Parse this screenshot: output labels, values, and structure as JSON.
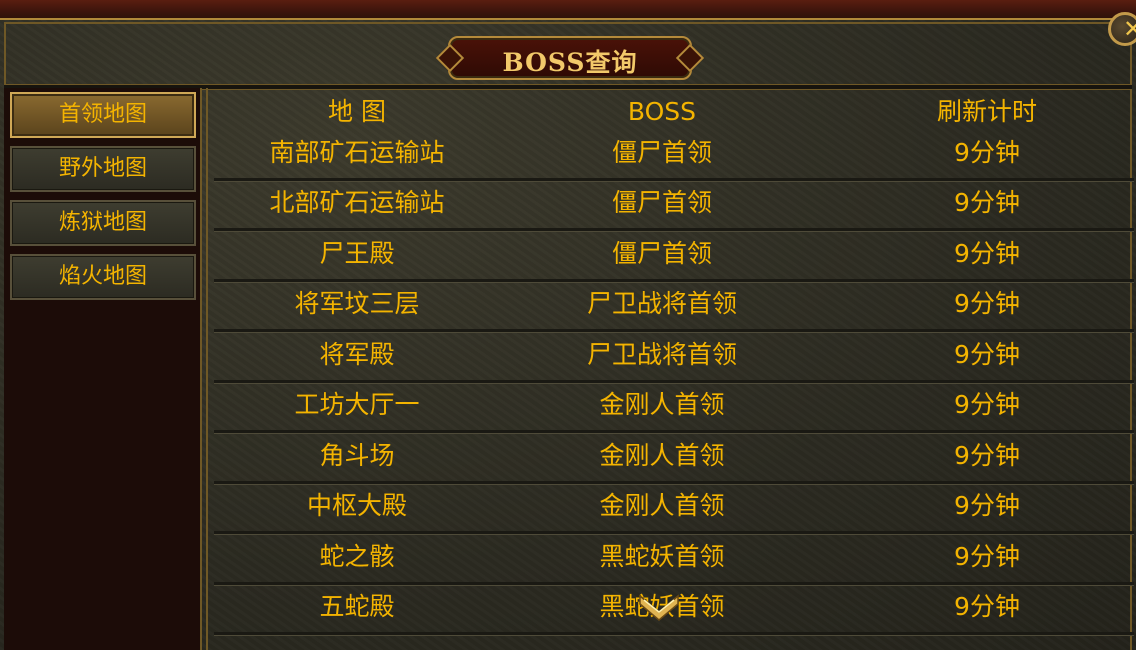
{
  "window": {
    "title": "BOSS查询",
    "close_icon": "close-icon"
  },
  "sidebar": {
    "items": [
      {
        "label": "首领地图",
        "active": true
      },
      {
        "label": "野外地图",
        "active": false
      },
      {
        "label": "炼狱地图",
        "active": false
      },
      {
        "label": "焰火地图",
        "active": false
      }
    ]
  },
  "table": {
    "headers": [
      "地 图",
      "BOSS",
      "刷新计时"
    ],
    "rows": [
      {
        "map": "南部矿石运输站",
        "boss": "僵尸首领",
        "timer": "9分钟"
      },
      {
        "map": "北部矿石运输站",
        "boss": "僵尸首领",
        "timer": "9分钟"
      },
      {
        "map": "尸王殿",
        "boss": "僵尸首领",
        "timer": "9分钟"
      },
      {
        "map": "将军坟三层",
        "boss": "尸卫战将首领",
        "timer": "9分钟"
      },
      {
        "map": "将军殿",
        "boss": "尸卫战将首领",
        "timer": "9分钟"
      },
      {
        "map": "工坊大厅一",
        "boss": "金刚人首领",
        "timer": "9分钟"
      },
      {
        "map": "角斗场",
        "boss": "金刚人首领",
        "timer": "9分钟"
      },
      {
        "map": "中枢大殿",
        "boss": "金刚人首领",
        "timer": "9分钟"
      },
      {
        "map": "蛇之骸",
        "boss": "黑蛇妖首领",
        "timer": "9分钟"
      },
      {
        "map": "五蛇殿",
        "boss": "黑蛇妖首领",
        "timer": "9分钟"
      }
    ]
  },
  "colors": {
    "text": "#f4b400",
    "title": "#f2c96a",
    "border": "#6f5826",
    "active_tab": "#8a6a30"
  }
}
